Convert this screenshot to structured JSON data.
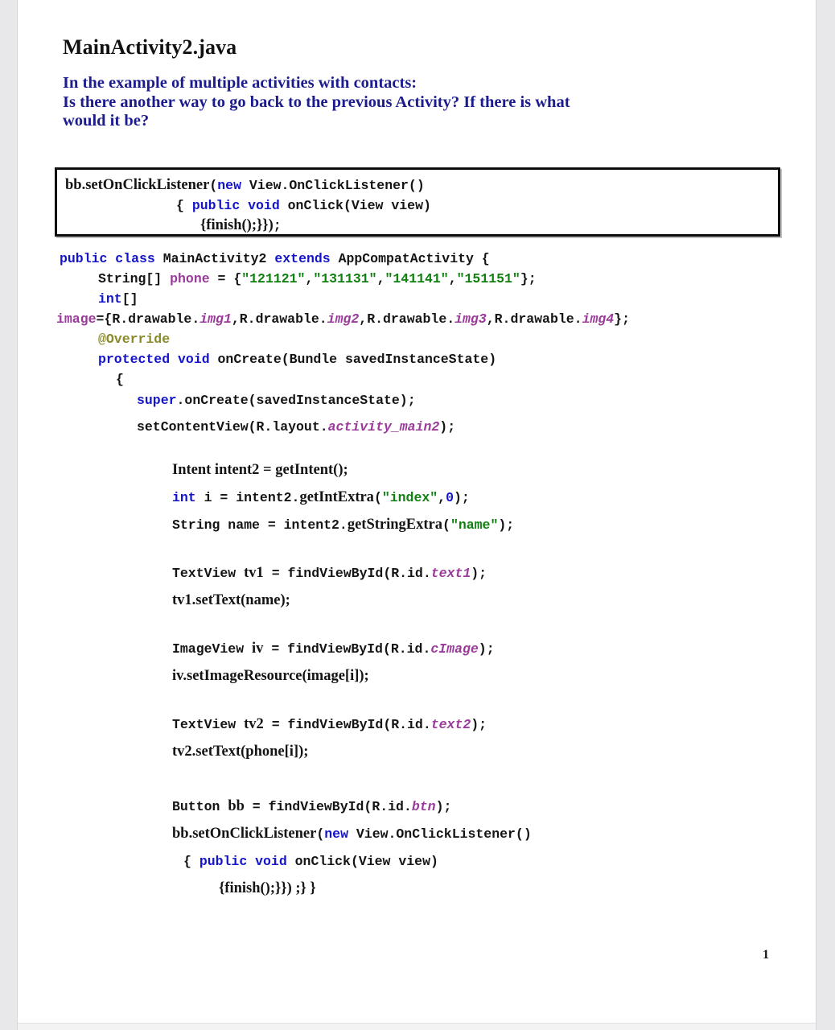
{
  "document": {
    "title": "MainActivity2.java",
    "page_number": "1"
  },
  "question": {
    "line1": "In the example of multiple activities with contacts:",
    "line2": "Is there another way to go back to the previous Activity? If there is what",
    "line3": "would it be?"
  },
  "highlight_box": {
    "line1": {
      "a": "bb.setOnClickListener",
      "b": "(",
      "c": "new",
      "d": " View.OnClickListener",
      "e": "()"
    },
    "line2": {
      "a": "{ ",
      "b": "public void",
      "c": " onClick",
      "d": "(View view)"
    },
    "line3": {
      "a": "{finish();}})",
      "b": ";"
    }
  },
  "code": {
    "l01": {
      "kw1": "public class",
      "t1": " MainActivity2 ",
      "kw2": "extends",
      "t2": " AppCompatActivity {"
    },
    "l02": {
      "t1": "String[] ",
      "id1": "phone",
      "t2": " = {",
      "s1": "\"121121\"",
      "t3": ",",
      "s2": "\"131131\"",
      "t4": ",",
      "s3": "\"141141\"",
      "t5": ",",
      "s4": "\"151151\"",
      "t6": "};"
    },
    "l03": {
      "kw1": "int",
      "t1": "[]"
    },
    "l04": {
      "id1": "image",
      "t1": "={R.drawable.",
      "i1": "img1",
      "t2": ",R.drawable.",
      "i2": "img2",
      "t3": ",R.drawable.",
      "i3": "img3",
      "t4": ",R.drawable.",
      "i4": "img4",
      "t5": "};"
    },
    "l05": {
      "anno": "@Override"
    },
    "l06": {
      "kw1": "protected void",
      "t1": " onCreate",
      "t2": "(Bundle savedInstanceState)"
    },
    "l07": {
      "t1": "{"
    },
    "l08": {
      "kw1": "super",
      "t1": ".onCreate",
      "t2": "(savedInstanceState)",
      "t3": ";"
    },
    "l09": {
      "t1": "setContentView",
      "t2": "(R.layout.",
      "i1": "activity_main2",
      "t3": ")",
      "t4": ";"
    },
    "l10": {
      "t1": "Intent intent2 = getIntent();"
    },
    "l11": {
      "kw1": "int",
      "t1": " i = intent2.",
      "b1": "getIntExtra",
      "t2": "(",
      "s1": "\"index\"",
      "t3": ",",
      "n1": "0",
      "t4": ");"
    },
    "l12": {
      "t1": "String name = intent2.",
      "b1": "getStringExtra",
      "t2": "(",
      "s1": "\"name\"",
      "t3": ");"
    },
    "l13": {
      "t1": "TextView ",
      "b1": "tv1",
      "t2": " = findViewById",
      "t3": "(R.id.",
      "i1": "text1",
      "t4": ");"
    },
    "l14": {
      "t1": "tv1.setText(name);"
    },
    "l15": {
      "t1": "ImageView ",
      "b1": "iv",
      "t2": " = findViewById",
      "t3": "(R.id.",
      "i1": "cImage",
      "t4": ");"
    },
    "l16": {
      "t1": "iv.setImageResource(image[i]);"
    },
    "l17": {
      "t1": "TextView ",
      "b1": "tv2",
      "t2": " = findViewById",
      "t3": "(R.id.",
      "i1": "text2",
      "t4": ");"
    },
    "l18": {
      "t1": "tv2.setText(phone[i]);"
    },
    "l19": {
      "t1": "Button ",
      "b1": "bb",
      "t2": " = findViewById",
      "t3": "(R.id.",
      "i1": "btn",
      "t4": ");"
    },
    "l20": {
      "t1": "bb.setOnClickListener",
      "t2": "(",
      "kw1": "new",
      "t3": " View.OnClickListener",
      "t4": "()"
    },
    "l21": {
      "t1": "{ ",
      "kw1": "public void",
      "t2": " onClick",
      "t3": "(View view)"
    },
    "l22": {
      "t1": "{finish();}})",
      "t2": " ;} }"
    }
  }
}
